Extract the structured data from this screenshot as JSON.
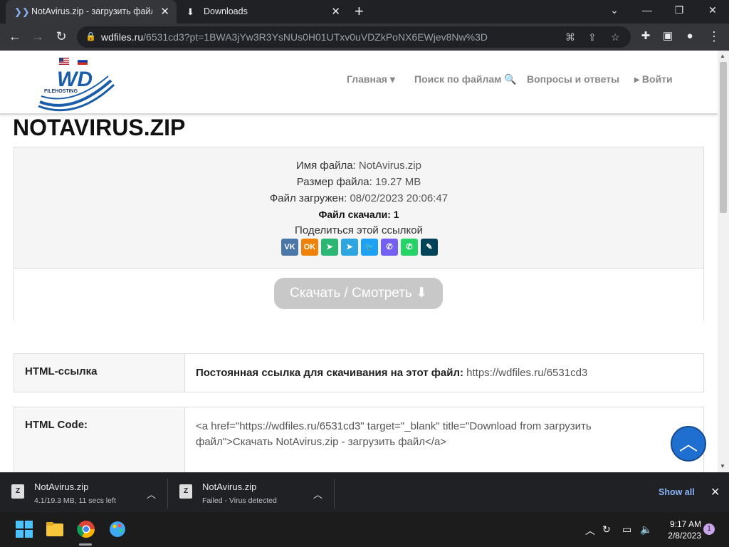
{
  "browser": {
    "tabs": [
      {
        "title": "NotAvirus.zip - загрузить файл",
        "close": "✕"
      },
      {
        "title": "Downloads",
        "close": "✕"
      }
    ],
    "new_tab": "+",
    "url_host": "wdfiles.ru",
    "url_path": "/6531cd3?pt=1BWA3jYw3R3YsNUs0H01UTxv0uVDZkPoNX6EWjev8Nw%3D"
  },
  "site": {
    "logo_text": "WD",
    "logo_sub": "FILEHOSTING",
    "nav": [
      "Главная ▾",
      "Поиск по файлам 🔍",
      "Вопросы и ответы",
      "▸ Войти"
    ]
  },
  "file": {
    "title": "NOTAVIRUS.ZIP",
    "name_label": "Имя файла:",
    "name_value": "NotAvirus.zip",
    "size_label": "Размер файла:",
    "size_value": "19.27 MB",
    "uploaded_label": "Файл загружен:",
    "uploaded_value": "08/02/2023 20:06:47",
    "downloads_text": "Файл скачали: 1",
    "share_label": "Поделиться этой ссылкой",
    "download_button": "Скачать / Смотреть ⬇"
  },
  "share_icons": [
    {
      "name": "vk",
      "glyph": "VK",
      "color": "#4a76a8"
    },
    {
      "name": "odnoklassniki",
      "glyph": "OK",
      "color": "#ee8208"
    },
    {
      "name": "messenger",
      "glyph": "➤",
      "color": "#2bb673"
    },
    {
      "name": "telegram",
      "glyph": "➤",
      "color": "#2ca5e0"
    },
    {
      "name": "twitter",
      "glyph": "🐦",
      "color": "#1da1f2"
    },
    {
      "name": "viber",
      "glyph": "✆",
      "color": "#7360f2"
    },
    {
      "name": "whatsapp",
      "glyph": "✆",
      "color": "#25d366"
    },
    {
      "name": "livejournal",
      "glyph": "✎",
      "color": "#004359"
    }
  ],
  "table": {
    "row1_label": "HTML-ссылка",
    "row1_bold": "Постоянная ссылка для скачивания на этот файл:",
    "row1_link": "https://wdfiles.ru/6531cd3",
    "row2_label": "HTML Code:",
    "row2_code": "<a href=\"https://wdfiles.ru/6531cd3\" target=\"_blank\" title=\"Download from загрузить файл\">Скачать NotAvirus.zip - загрузить файл</a>"
  },
  "downloads_bar": {
    "items": [
      {
        "name": "NotAvirus.zip",
        "status": "4.1/19.3 MB, 11 secs left"
      },
      {
        "name": "NotAvirus.zip",
        "status": "Failed - Virus detected"
      }
    ],
    "show_all": "Show all"
  },
  "taskbar": {
    "time": "9:17 AM",
    "date": "2/8/2023",
    "notifications": "1"
  }
}
